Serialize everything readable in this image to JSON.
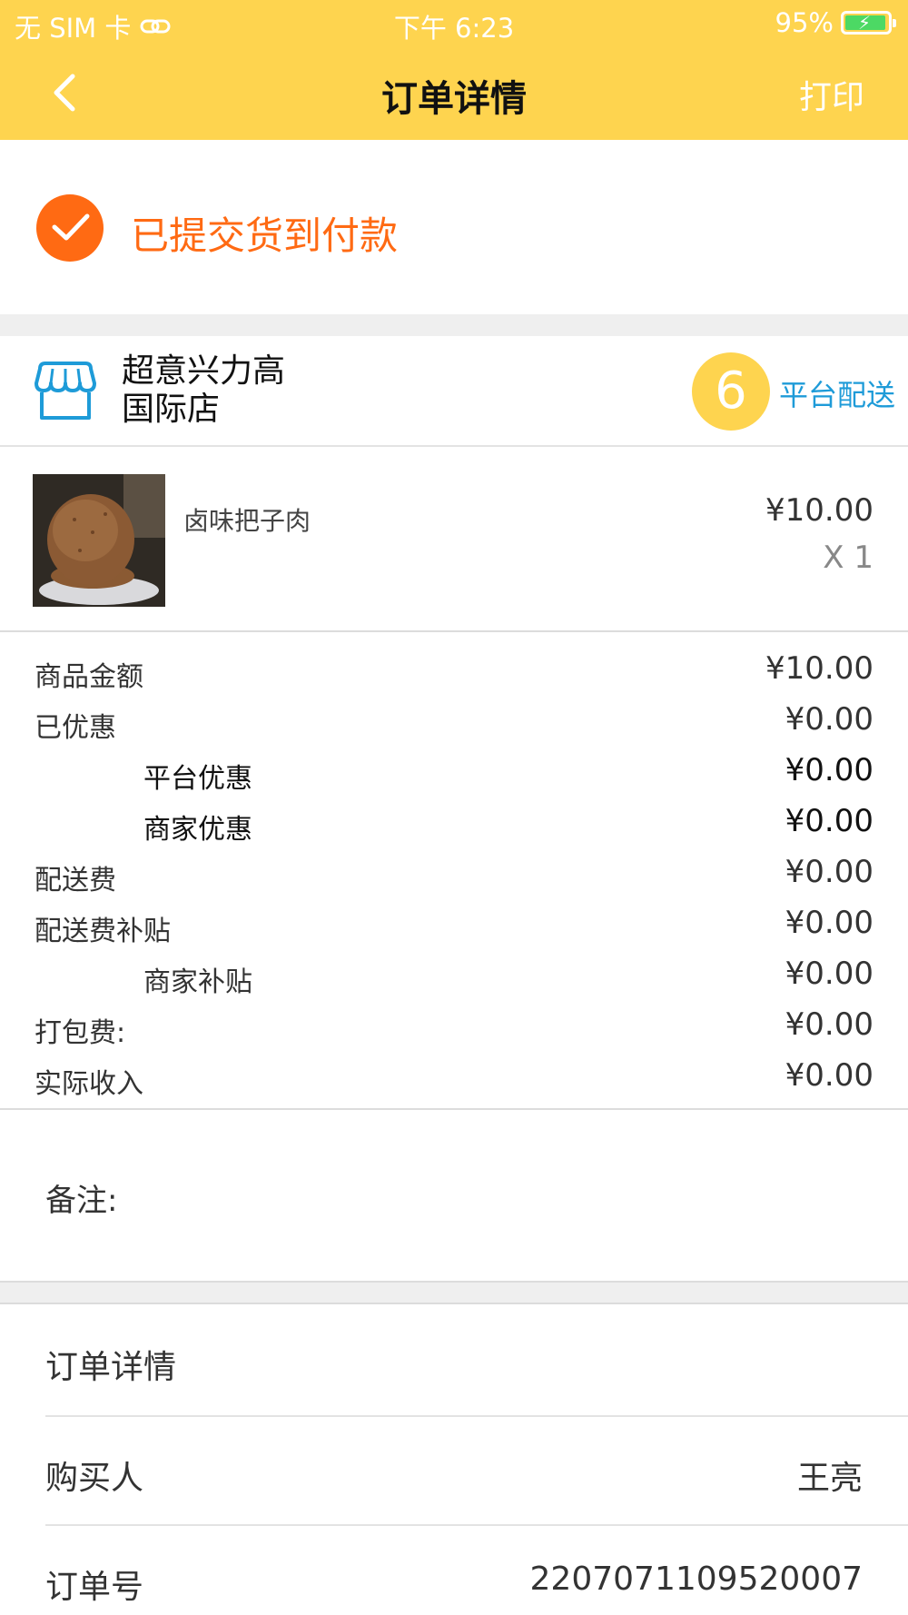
{
  "status_bar": {
    "carrier": "无 SIM 卡",
    "time": "下午 6:23",
    "battery": "95%",
    "battery_level": 0.95
  },
  "nav": {
    "title": "订单详情",
    "print": "打印"
  },
  "order_status": {
    "text": "已提交货到付款"
  },
  "store": {
    "name_line1": "超意兴力高",
    "name_line2": "国际店",
    "badge": "6",
    "delivery": "平台配送"
  },
  "product": {
    "name": "卤味把子肉",
    "price": "¥10.00",
    "qty": "X 1"
  },
  "money": [
    {
      "label": "商品金额",
      "value": "¥10.00"
    },
    {
      "label": "已优惠",
      "value": "¥0.00"
    },
    {
      "label": "平台优惠",
      "value": "¥0.00"
    },
    {
      "label": "商家优惠",
      "value": "¥0.00"
    },
    {
      "label": "配送费",
      "value": "¥0.00"
    },
    {
      "label": "配送费补贴",
      "value": "¥0.00"
    },
    {
      "label": "商家补贴",
      "value": "¥0.00"
    },
    {
      "label": "打包费:",
      "value": "¥0.00"
    },
    {
      "label": "实际收入",
      "value": "¥0.00"
    }
  ],
  "remark": {
    "label": "备注:"
  },
  "details": {
    "header": "订单详情",
    "buyer_label": "购买人",
    "buyer_value": "王亮",
    "order_no_label": "订单号",
    "order_no_value": "2207071109520007"
  },
  "colors": {
    "accent": "#fed44f",
    "status_orange": "#ff6a13",
    "link_blue": "#1e9bd8"
  }
}
